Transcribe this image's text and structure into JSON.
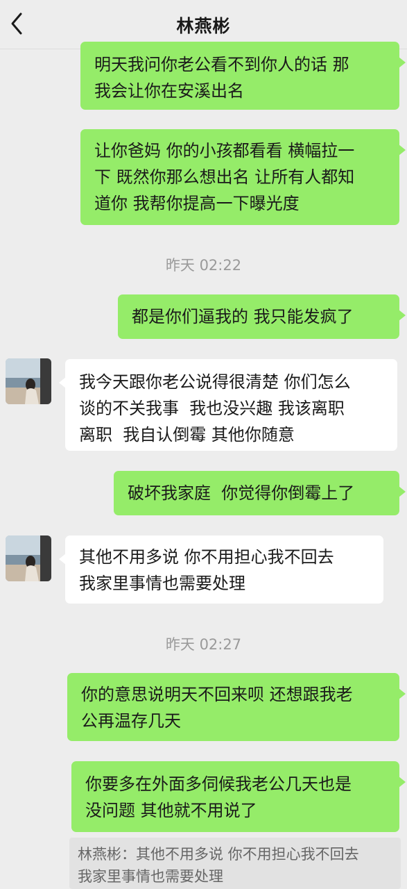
{
  "header": {
    "title": "林燕彬",
    "back_icon": "chevron-left-icon"
  },
  "messages": [
    {
      "type": "out",
      "text": "明天我问你老公看不到你人的话 那\n我会让你在安溪出名"
    },
    {
      "type": "out",
      "text": "让你爸妈 你的小孩都看看 横幅拉一\n下 既然你那么想出名 让所有人都知\n道你 我帮你提高一下曝光度"
    },
    {
      "type": "time",
      "text": "昨天 02:22"
    },
    {
      "type": "out",
      "text": "都是你们逼我的 我只能发疯了"
    },
    {
      "type": "in",
      "text": "我今天跟你老公说得很清楚 你们怎么\n谈的不关我事  我也没兴趣 我该离职\n离职  我自认倒霉 其他你随意"
    },
    {
      "type": "out",
      "text": "破坏我家庭  你觉得你倒霉上了"
    },
    {
      "type": "in",
      "text": "其他不用多说 你不用担心我不回去\n我家里事情也需要处理"
    },
    {
      "type": "time",
      "text": "昨天 02:27"
    },
    {
      "type": "out",
      "text": "你的意思说明天不回来呗 还想跟我老\n公再温存几天"
    },
    {
      "type": "out",
      "text": "你要多在外面多伺候我老公几天也是\n没问题 其他就不用说了"
    }
  ],
  "quote": {
    "text": "林燕彬：其他不用多说 你不用担心我不回去\n我家里事情也需要处理"
  },
  "colors": {
    "outgoing": "#95ec69",
    "incoming": "#ffffff",
    "background": "#ededed"
  }
}
